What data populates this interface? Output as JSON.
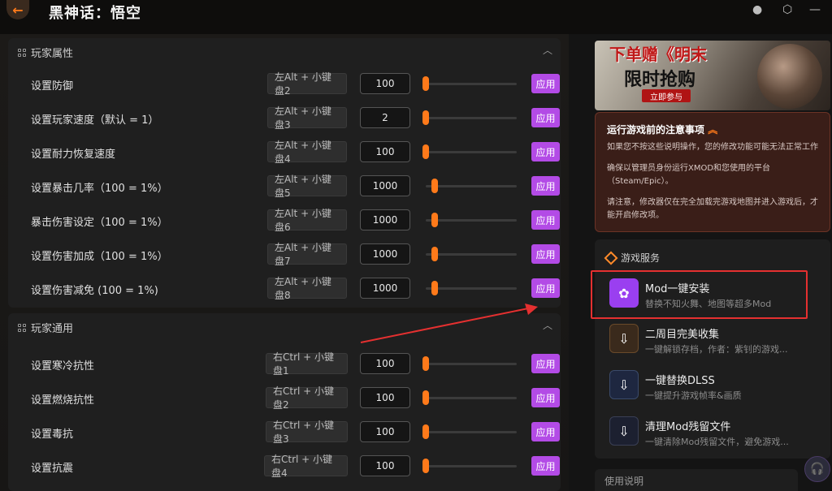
{
  "app": {
    "title": "黑神话：悟空"
  },
  "window": {
    "back_icon": "arrow-left-icon"
  },
  "section_player_attrs": {
    "title": "玩家属性",
    "rows": [
      {
        "label": "设置防御",
        "hotkey": "左Alt + 小键盘2",
        "value": "100",
        "apply": "应用"
      },
      {
        "label": "设置玩家速度（默认 = 1）",
        "hotkey": "左Alt + 小键盘3",
        "value": "2",
        "apply": "应用"
      },
      {
        "label": "设置耐力恢复速度",
        "hotkey": "左Alt + 小键盘4",
        "value": "100",
        "apply": "应用"
      },
      {
        "label": "设置暴击几率（100 = 1%）",
        "hotkey": "左Alt + 小键盘5",
        "value": "1000",
        "apply": "应用"
      },
      {
        "label": "暴击伤害设定（100 = 1%）",
        "hotkey": "左Alt + 小键盘6",
        "value": "1000",
        "apply": "应用"
      },
      {
        "label": "设置伤害加成（100 = 1%）",
        "hotkey": "左Alt + 小键盘7",
        "value": "1000",
        "apply": "应用"
      },
      {
        "label": "设置伤害减免 (100 = 1%)",
        "hotkey": "左Alt + 小键盘8",
        "value": "1000",
        "apply": "应用"
      }
    ]
  },
  "section_player_general": {
    "title": "玩家通用",
    "rows": [
      {
        "label": "设置寒冷抗性",
        "hotkey": "右Ctrl + 小键盘1",
        "value": "100",
        "apply": "应用"
      },
      {
        "label": "设置燃烧抗性",
        "hotkey": "右Ctrl + 小键盘2",
        "value": "100",
        "apply": "应用"
      },
      {
        "label": "设置毒抗",
        "hotkey": "右Ctrl + 小键盘3",
        "value": "100",
        "apply": "应用"
      },
      {
        "label": "设置抗震",
        "hotkey": "右Ctrl + 小键盘4",
        "value": "100",
        "apply": "应用"
      }
    ]
  },
  "promo": {
    "line1": "下单赠《明末",
    "line2": "限时抢购",
    "button": "立即参与"
  },
  "notice": {
    "title": "运行游戏前的注意事项",
    "p1": "如果您不按这些说明操作，您的修改功能可能无法正常工作",
    "p2": "确保以管理员身份运行XMOD和您使用的平台（Steam/Epic）。",
    "p3": "请注意，修改器仅在完全加载完游戏地图并进入游戏后，才能开启修改项。"
  },
  "services": {
    "title": "游戏服务",
    "items": [
      {
        "title": "Mod一键安装",
        "subtitle": "替换不知火舞、地图等超多Mod"
      },
      {
        "title": "二周目完美收集",
        "subtitle": "一键解锁存档，作者：紫钊的游戏..."
      },
      {
        "title": "一键替换DLSS",
        "subtitle": "一键提升游戏帧率&画质"
      },
      {
        "title": "清理Mod残留文件",
        "subtitle": "一键清除Mod残留文件，避免游戏..."
      }
    ]
  },
  "bottom_card": {
    "title": "使用说明"
  },
  "colors": {
    "accent_orange": "#ff7a1a",
    "apply_purple": "#b34be6",
    "highlight_red": "#e53030"
  }
}
